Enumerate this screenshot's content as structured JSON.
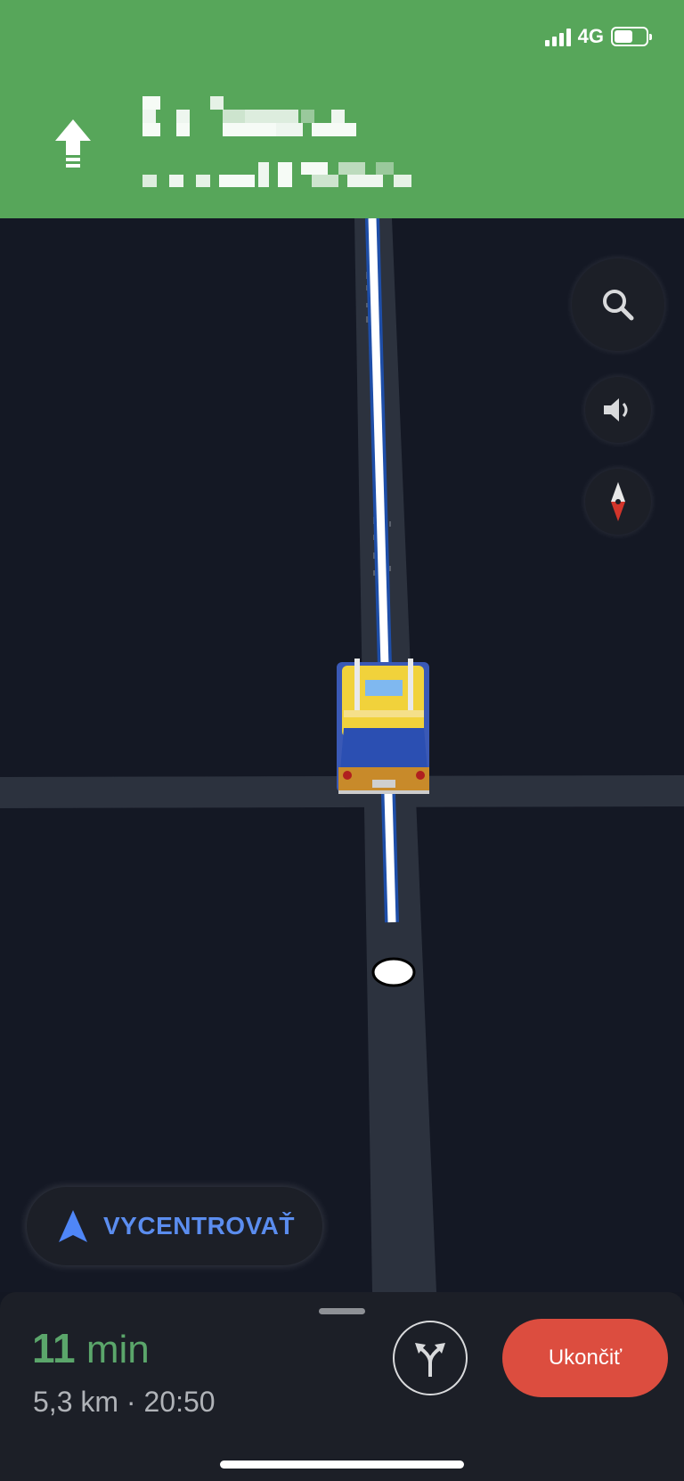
{
  "status_bar": {
    "network": "4G"
  },
  "header": {
    "maneuver_icon": "straight-arrow-icon",
    "bg_color": "#57a65a"
  },
  "map": {
    "buttons": {
      "search_icon": "search-icon",
      "sound_icon": "volume-icon",
      "compass_icon": "compass-icon"
    },
    "recenter_label": "VYCENTROVAŤ",
    "recenter_icon": "navigation-arrow-icon"
  },
  "trip": {
    "duration_value": "11",
    "duration_unit": "min",
    "details": "5,3 km · 20:50"
  },
  "actions": {
    "alt_routes_icon": "alternate-routes-icon",
    "exit_label": "Ukončiť",
    "exit_color": "#dc4d3f"
  }
}
